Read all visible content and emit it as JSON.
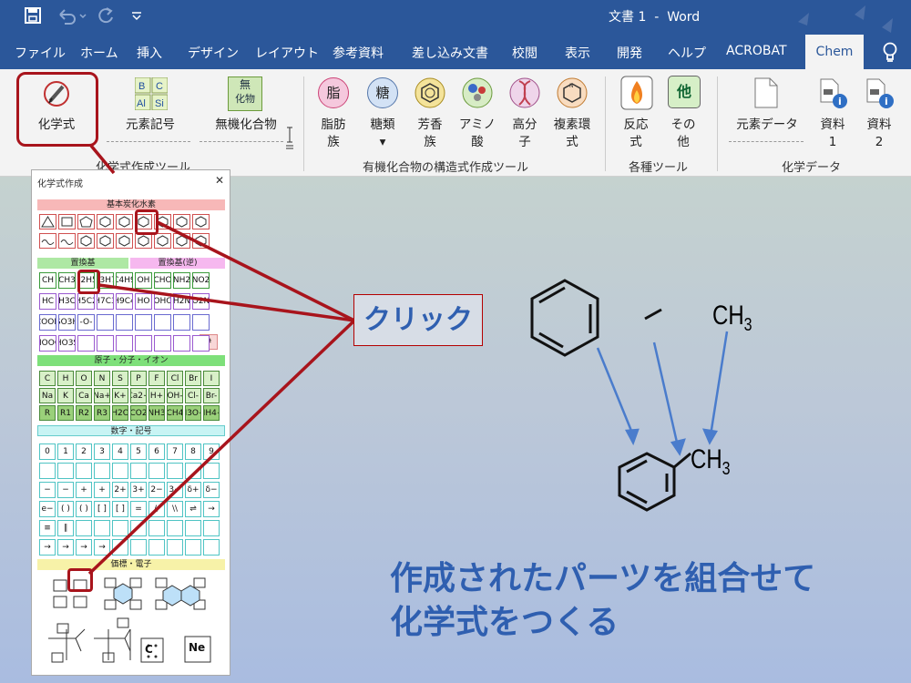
{
  "titlebar": {
    "doc_title": "文書 1  -  Word"
  },
  "tabs": [
    "ファイル",
    "ホーム",
    "挿入",
    "デザイン",
    "レイアウト",
    "参考資料",
    "差し込み文書",
    "校閲",
    "表示",
    "開発",
    "ヘルプ",
    "ACROBAT",
    "Chem"
  ],
  "ribbon": {
    "chem_formula": "化学式",
    "element_symbol": "元素記号",
    "inorganic": "無機化合物",
    "group1": "化学式作成ツール",
    "fat1": "脂肪",
    "fat2": "族",
    "sugar": "糖類",
    "arom1": "芳香",
    "arom2": "族",
    "amino1": "アミノ",
    "amino2": "酸",
    "poly1": "高分",
    "poly2": "子",
    "hetero1": "複素環",
    "hetero2": "式",
    "group2": "有機化合物の構造式作成ツール",
    "react1": "反応",
    "react2": "式",
    "other1": "その",
    "other2": "他",
    "group3": "各種ツール",
    "eldata": "元素データ",
    "ref1a": "資料",
    "ref1b": "1",
    "ref2a": "資料",
    "ref2b": "2",
    "group4": "化学データ",
    "icon_glyphs": {
      "fat": "脂",
      "sugar": "糖",
      "other": "他",
      "inorg_top": "無",
      "inorg_bot": "化物",
      "amino_small": "Amino Acid"
    }
  },
  "palette": {
    "title": "化学式作成",
    "close": "✕",
    "sec_hydrocarbon": "基本炭化水素",
    "sec_subst": "置換基",
    "sec_subst_rev": "置換基(逆)",
    "sec_atoms": "原子・分子・イオン",
    "sec_numbers": "数字・記号",
    "sec_electron": "価標・電子",
    "subst_row1": [
      "CH",
      "CH3",
      "C2H5",
      "C3H7",
      "C4H9",
      "OH",
      "CHO",
      "NH2",
      "NO2"
    ],
    "subst_row2": [
      "HC",
      "H3C",
      "H5C2",
      "H7C3",
      "H9C4",
      "HO",
      "OHC",
      "H2N",
      "O2N"
    ],
    "subst_row3": [
      "COOH",
      "SO3H",
      "-O-",
      "",
      "",
      "",
      "",
      "",
      ""
    ],
    "subst_row4": [
      "HOOC",
      "HO3S",
      "",
      "",
      "",
      "",
      "",
      "",
      ""
    ],
    "hash": "#",
    "atoms_row1": [
      "C",
      "H",
      "O",
      "N",
      "S",
      "P",
      "F",
      "Cl",
      "Br",
      "I"
    ],
    "atoms_row2": [
      "Na",
      "K",
      "Ca",
      "Na+",
      "K+",
      "Ca2+",
      "H+",
      "OH-",
      "Cl-",
      "Br-"
    ],
    "atoms_row3": [
      "R",
      "R1",
      "R2",
      "R3",
      "H2O",
      "CO2",
      "NH3",
      "CH4",
      "H3O+",
      "NH4+"
    ],
    "num_row1": [
      "0",
      "1",
      "2",
      "3",
      "4",
      "5",
      "6",
      "7",
      "8",
      "9"
    ],
    "num_row2": [
      "",
      "",
      "",
      "",
      "",
      "",
      "",
      "",
      "",
      ""
    ],
    "num_row3": [
      "−",
      "−",
      "+",
      "+",
      "2+",
      "3+",
      "2−",
      "3−",
      "δ+",
      "δ−"
    ],
    "num_row4": [
      "e−",
      "( )",
      "( )",
      "[ ]",
      "[ ]",
      "=",
      "//",
      "\\\\",
      "⇌",
      "→"
    ],
    "num_row5": [
      "≡",
      "∥",
      "",
      "",
      "",
      "",
      "",
      "",
      "",
      ""
    ],
    "num_row6": [
      "→",
      "→",
      "→",
      "→",
      "",
      "",
      "",
      "",
      "",
      ""
    ],
    "electron_c": "C",
    "electron_ne": "Ne"
  },
  "annotation": {
    "click": "クリック",
    "caption_line1": "作成されたパーツを組合せて",
    "caption_line2": "化学式をつくる"
  },
  "chem": {
    "ch3_main": "CH",
    "ch3_sub": "3"
  },
  "colors": {
    "word_blue": "#2b579a",
    "highlight_red": "#a8141c",
    "text_blue": "#2f5fb0",
    "arrow_blue": "#4a7ccc"
  }
}
